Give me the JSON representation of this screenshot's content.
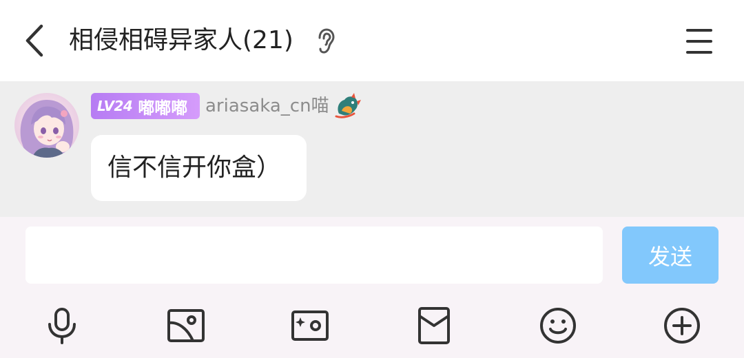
{
  "header": {
    "title": "相侵相碍异家人(21)",
    "icons": [
      "back-arrow-icon",
      "ear-icon",
      "menu-icon"
    ]
  },
  "message": {
    "level": "LV24",
    "badge_name": "嘟嘟嘟",
    "username": "ariasaka_cn喵",
    "text": "信不信开你盒）",
    "badge_color": "#b67cf3"
  },
  "composer": {
    "input_value": "",
    "send_label": "发送",
    "send_color": "#82c8fc"
  },
  "toolbar": {
    "items": [
      "microphone-icon",
      "image-icon",
      "camera-icon",
      "red-packet-icon",
      "emoji-icon",
      "plus-icon"
    ]
  }
}
